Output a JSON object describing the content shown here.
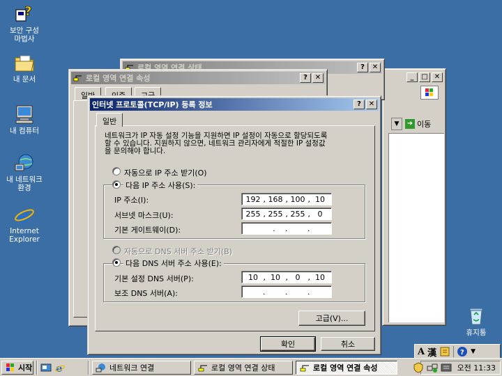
{
  "desktop": {
    "icons": [
      {
        "label": "보안 구성\n마법사"
      },
      {
        "label": "내 문서"
      },
      {
        "label": "내 컴퓨터"
      },
      {
        "label": "내 네트워크\n환경"
      },
      {
        "label": "Internet\nExplorer"
      },
      {
        "label": "휴지통"
      }
    ]
  },
  "status_window": {
    "title": "로컬 영역 연결 상태"
  },
  "explorer_window": {
    "go_label": "이동"
  },
  "props_window": {
    "title": "로컬 영역 연결 속성",
    "tabs": [
      "일반",
      "인증",
      "고급"
    ]
  },
  "tcpip_dialog": {
    "title": "인터넷 프로토콜(TCP/IP) 등록 정보",
    "tab": "일반",
    "description": "네트워크가 IP 자동 설정 기능을 지원하면 IP 설정이 자동으로 할당되도록\n할 수 있습니다. 지원하지 않으면, 네트워크 관리자에게 적절한 IP 설정값\n을 문의해야 합니다.",
    "auto_ip_label": "자동으로 IP 주소 받기(O)",
    "manual_ip_label": "다음 IP 주소 사용(S):",
    "ip_label": "IP 주소(I):",
    "subnet_label": "서브넷 마스크(U):",
    "gateway_label": "기본 게이트웨이(D):",
    "ip_address": [
      "192",
      "168",
      "100",
      "10"
    ],
    "subnet_mask": [
      "255",
      "255",
      "255",
      "0"
    ],
    "gateway": [
      "",
      "",
      "",
      ""
    ],
    "auto_dns_label": "자동으로 DNS 서버 주소 받기(B)",
    "manual_dns_label": "다음 DNS 서버 주소 사용(E):",
    "pref_dns_label": "기본 설정 DNS 서버(P):",
    "alt_dns_label": "보조 DNS 서버(A):",
    "preferred_dns": [
      "10",
      "10",
      "0",
      "10"
    ],
    "alternate_dns": [
      "",
      "",
      "",
      ""
    ],
    "advanced_button": "고급(V)...",
    "ok_button": "확인",
    "cancel_button": "취소"
  },
  "taskbar": {
    "start_label": "시작",
    "items": [
      "네트워크 연결",
      "로컬 영역 연결 상태",
      "로컬 영역 연결 속성"
    ],
    "clock": "오전 11:33",
    "ime_a": "A",
    "ime_han": "漢"
  },
  "colors": {
    "desktop": "#3a6ea5",
    "title_active": "#0a246a",
    "title_inactive": "#808080",
    "face": "#d4d0c8"
  }
}
